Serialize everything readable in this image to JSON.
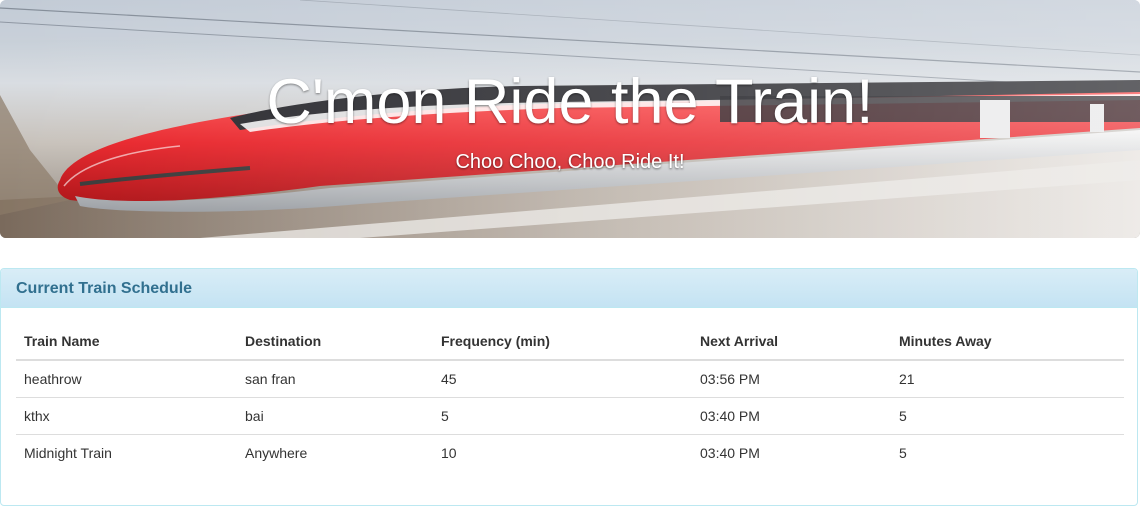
{
  "hero": {
    "title": "C'mon Ride the Train!",
    "subtitle": "Choo Choo, Choo Ride It!"
  },
  "panel": {
    "heading": "Current Train Schedule"
  },
  "table": {
    "headers": [
      "Train Name",
      "Destination",
      "Frequency (min)",
      "Next Arrival",
      "Minutes Away"
    ],
    "rows": [
      [
        "heathrow",
        "san fran",
        "45",
        "03:56 PM",
        "21"
      ],
      [
        "kthx",
        "bai",
        "5",
        "03:40 PM",
        "5"
      ],
      [
        "Midnight Train",
        "Anywhere",
        "10",
        "03:40 PM",
        "5"
      ]
    ]
  },
  "colors": {
    "panel_heading_text": "#31708f",
    "panel_border": "#bce8f1",
    "train_red": "#e8262c"
  }
}
